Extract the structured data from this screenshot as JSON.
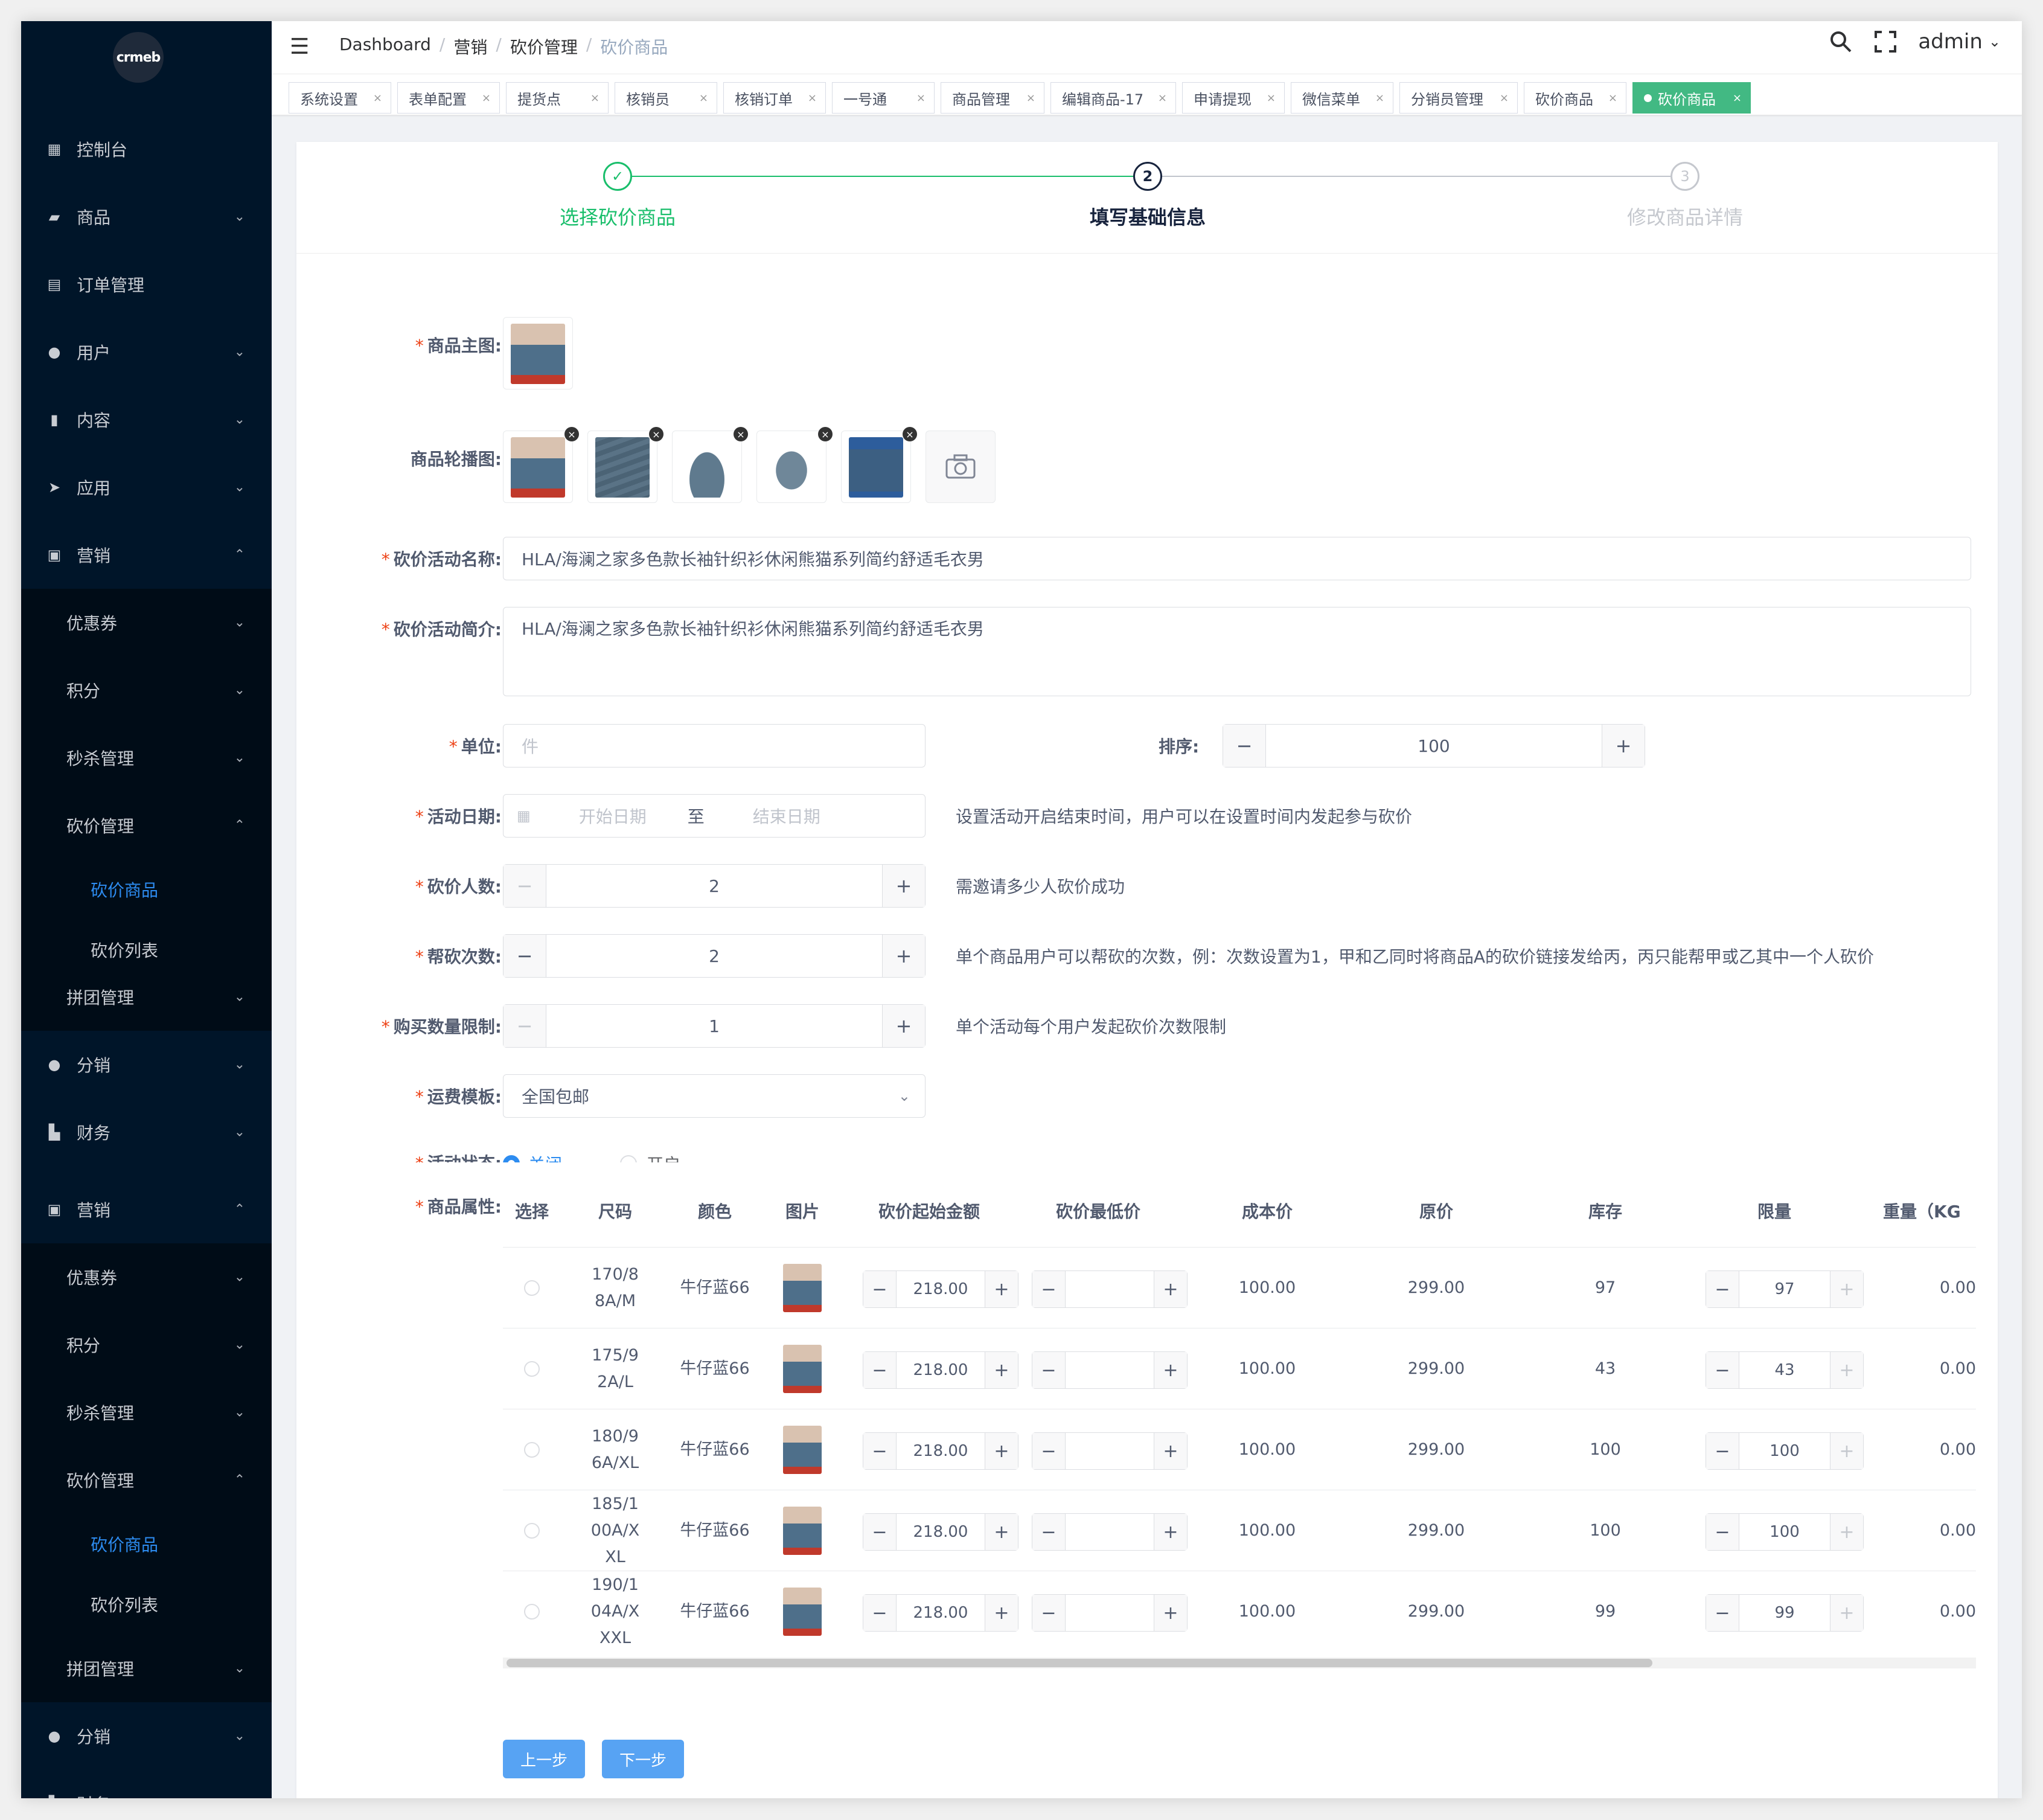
{
  "app": {
    "logo_text": "crmeb"
  },
  "sidebar": {
    "top_items": [
      {
        "label": "控制台",
        "icon": "dashboard-icon"
      },
      {
        "label": "商品",
        "icon": "bag-icon"
      },
      {
        "label": "订单管理",
        "icon": "clipboard-icon"
      },
      {
        "label": "用户",
        "icon": "user-icon"
      },
      {
        "label": "内容",
        "icon": "book-icon"
      },
      {
        "label": "应用",
        "icon": "send-icon"
      },
      {
        "label": "营销",
        "icon": "chart-icon"
      }
    ],
    "marketing_children": [
      "优惠券",
      "积分",
      "秒杀管理",
      "砍价管理"
    ],
    "bargain_children": [
      "砍价商品",
      "砍价列表"
    ],
    "group_label": "拼团管理",
    "distribution_label": "分销",
    "finance_label": "财务"
  },
  "header": {
    "breadcrumb": [
      "Dashboard",
      "营销",
      "砍价管理",
      "砍价商品"
    ],
    "breadcrumb_sep": "/",
    "username": "admin",
    "username_caret": "⌄"
  },
  "tags": [
    "系统设置",
    "表单配置",
    "提货点",
    "核销员",
    "核销订单",
    "一号通",
    "商品管理",
    "编辑商品-17",
    "申请提现",
    "微信菜单",
    "分销员管理",
    "砍价商品",
    "砍价商品"
  ],
  "steps": [
    {
      "num": "✓",
      "title": "选择砍价商品"
    },
    {
      "num": "2",
      "title": "填写基础信息"
    },
    {
      "num": "3",
      "title": "修改商品详情"
    }
  ],
  "form": {
    "required_mark": "*",
    "main_image_label": "商品主图:",
    "carousel_label": "商品轮播图:",
    "name_label": "砍价活动名称:",
    "name_value": "HLA/海澜之家多色款长袖针织衫休闲熊猫系列简约舒适毛衣男",
    "intro_label": "砍价活动简介:",
    "intro_value": "HLA/海澜之家多色款长袖针织衫休闲熊猫系列简约舒适毛衣男",
    "unit_label": "单位:",
    "unit_placeholder": "件",
    "sort_label": "排序:",
    "sort_value": "100",
    "date_label": "活动日期:",
    "date_start_placeholder": "开始日期",
    "date_to": "至",
    "date_end_placeholder": "结束日期",
    "date_tip": "设置活动开启结束时间，用户可以在设置时间内发起参与砍价",
    "people_label": "砍价人数:",
    "people_value": "2",
    "people_tip": "需邀请多少人砍价成功",
    "help_label": "帮砍次数:",
    "help_value": "2",
    "help_tip": "单个商品用户可以帮砍的次数，例：次数设置为1，甲和乙同时将商品A的砍价链接发给丙，丙只能帮甲或乙其中一个人砍价",
    "buy_label": "购买数量限制:",
    "buy_value": "1",
    "buy_tip": "单个活动每个用户发起砍价次数限制",
    "shipping_label": "运费模板:",
    "shipping_value": "全国包邮",
    "status_label": "活动状态:",
    "status_options": [
      "关闭",
      "开启"
    ],
    "attr_label": "商品属性:",
    "minus": "−",
    "plus": "+"
  },
  "table": {
    "headers": [
      "选择",
      "尺码",
      "颜色",
      "图片",
      "砍价起始金额",
      "砍价最低价",
      "成本价",
      "原价",
      "库存",
      "限量",
      "重量（KG"
    ],
    "rows": [
      {
        "size": "170/88A/M",
        "color": "牛仔蓝66",
        "start": "218.00",
        "min": "",
        "cost": "100.00",
        "price": "299.00",
        "stock": "97",
        "limit": "97",
        "weight": "0.00"
      },
      {
        "size": "175/92A/L",
        "color": "牛仔蓝66",
        "start": "218.00",
        "min": "",
        "cost": "100.00",
        "price": "299.00",
        "stock": "43",
        "limit": "43",
        "weight": "0.00"
      },
      {
        "size": "180/96A/XL",
        "color": "牛仔蓝66",
        "start": "218.00",
        "min": "",
        "cost": "100.00",
        "price": "299.00",
        "stock": "100",
        "limit": "100",
        "weight": "0.00"
      },
      {
        "size": "185/100A/XXL",
        "color": "牛仔蓝66",
        "start": "218.00",
        "min": "",
        "cost": "100.00",
        "price": "299.00",
        "stock": "100",
        "limit": "100",
        "weight": "0.00"
      },
      {
        "size": "190/104A/XXXL",
        "color": "牛仔蓝66",
        "start": "218.00",
        "min": "",
        "cost": "100.00",
        "price": "299.00",
        "stock": "99",
        "limit": "99",
        "weight": "0.00"
      }
    ]
  },
  "buttons": {
    "prev": "上一步",
    "next": "下一步"
  },
  "colors": {
    "sidebar_bg": "#001529",
    "active": "#2d8cf0",
    "tag_active": "#42b983",
    "step_done": "#19be6b",
    "button": "#57a3f3"
  }
}
